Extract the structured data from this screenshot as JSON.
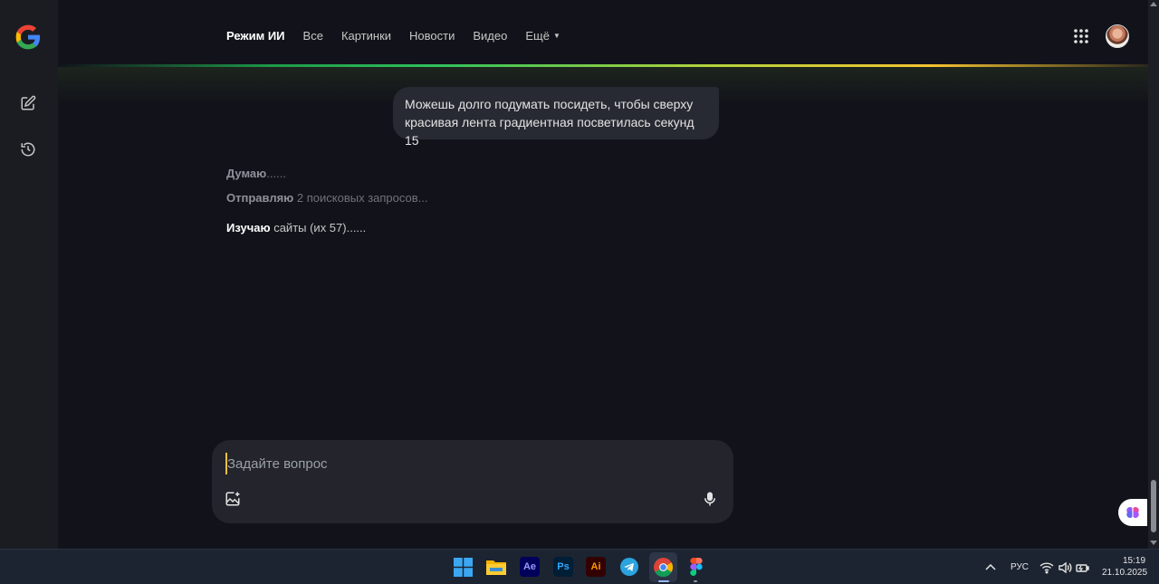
{
  "nav": {
    "tabs": [
      {
        "label": "Режим ИИ",
        "active": true
      },
      {
        "label": "Все"
      },
      {
        "label": "Картинки"
      },
      {
        "label": "Новости"
      },
      {
        "label": "Видео"
      },
      {
        "label": "Ещё"
      }
    ]
  },
  "chat": {
    "user_message": "Можешь долго подумать посидеть, чтобы сверху красивая лента градиентная посветилась секунд 15",
    "steps": [
      {
        "bold": "Думаю",
        "rest": "......"
      },
      {
        "bold": "Отправляю",
        "rest": " 2 поисковых запросов..."
      },
      {
        "bold": "Изучаю",
        "rest": " сайты (их 57)......"
      }
    ]
  },
  "composer": {
    "placeholder": "Задайте вопрос"
  },
  "taskbar": {
    "apps": [
      "windows-start",
      "file-explorer",
      "after-effects",
      "photoshop",
      "illustrator",
      "telegram",
      "chrome",
      "figma"
    ],
    "ae_label": "Ae",
    "ps_label": "Ps",
    "ai_label": "Ai",
    "language": "РУС",
    "time": "15:19",
    "date": "21.10.2025"
  },
  "colors": {
    "background": "#12131a",
    "rail": "#1b1c22",
    "bubble": "#282a33",
    "composer": "#23242c",
    "taskbar": "#1c2431",
    "gradient_green": "#31c25d",
    "gradient_yellow": "#f4c430"
  }
}
